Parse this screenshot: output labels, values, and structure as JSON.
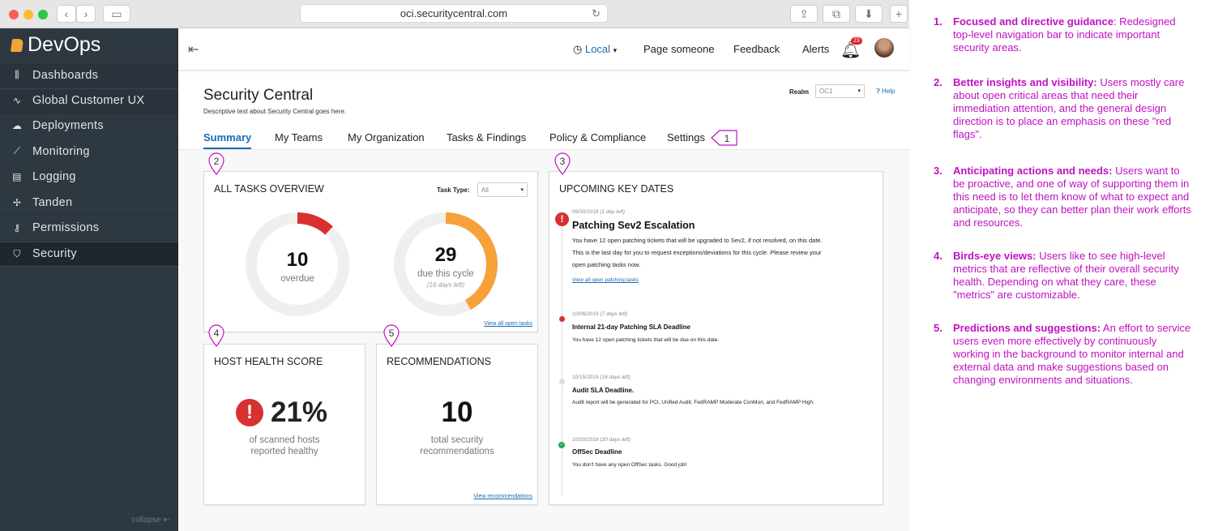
{
  "browser": {
    "url": "oci.securitycentral.com"
  },
  "app": {
    "name": "DevOps",
    "collapse_label": "collapse"
  },
  "sidebar": {
    "items": [
      {
        "label": "Dashboards",
        "icon": "sliders-icon"
      },
      {
        "label": "Global Customer UX",
        "icon": "pulse-icon"
      },
      {
        "label": "Deployments",
        "icon": "cloud-upload-icon"
      },
      {
        "label": "Monitoring",
        "icon": "chart-icon"
      },
      {
        "label": "Logging",
        "icon": "log-icon"
      },
      {
        "label": "Tanden",
        "icon": "tanden-icon"
      },
      {
        "label": "Permissions",
        "icon": "key-icon"
      },
      {
        "label": "Security",
        "icon": "shield-icon"
      }
    ]
  },
  "topbar": {
    "region": "Local",
    "page_someone": "Page someone",
    "feedback": "Feedback",
    "alerts": "Alerts",
    "alert_count": "23"
  },
  "page": {
    "title": "Security Central",
    "description": "Descriptive text about Security Central goes here.",
    "realm_label": "Realm",
    "realm_value": "OC1",
    "help": "Help"
  },
  "tabs": [
    "Summary",
    "My Teams",
    "My Organization",
    "Tasks & Findings",
    "Policy & Compliance",
    "Settings"
  ],
  "tasks": {
    "title": "ALL TASKS OVERVIEW",
    "task_type_label": "Task Type:",
    "task_type_value": "All",
    "overdue_value": "10",
    "overdue_label": "overdue",
    "overdue_fraction": 0.12,
    "due_value": "29",
    "due_label": "due this cycle",
    "due_sub": "(16 days left)",
    "due_fraction": 0.42,
    "view_link": "View all open tasks"
  },
  "host": {
    "title": "HOST HEALTH SCORE",
    "value": "21%",
    "label1": "of scanned hosts",
    "label2": "reported healthy"
  },
  "recs": {
    "title": "RECOMMENDATIONS",
    "value": "10",
    "label1": "total security",
    "label2": "recommendations",
    "link": "View recommendations"
  },
  "dates": {
    "title": "UPCOMING KEY DATES",
    "items": [
      {
        "date": "09/30/2019",
        "rel": "(1 day left)",
        "title": "Patching Sev2 Escalation",
        "desc": [
          "You have 12 open patching tickets that will be upgraded to Sev2, if not resolved, on this date.",
          "This is the last day for you to request exceptions/deviations for this cycle. Please review your",
          "open patching tasks now."
        ],
        "link": "View all open patching tasks",
        "status": "critical"
      },
      {
        "date": "10/06/2019",
        "rel": "(7 days left)",
        "title": "Internal 21-day Patching SLA Deadline",
        "desc": [
          "You have 12 open patching tickets that will be due on this date."
        ],
        "status": "warning"
      },
      {
        "date": "10/15/2019",
        "rel": "(16 days left)",
        "title": "Audit SLA Deadline.",
        "desc": [
          "Audit report will be generated for PCI, Unified Audit, FedRAMP Moderate ConMon, and FedRAMP High."
        ],
        "status": "neutral"
      },
      {
        "date": "10/20/2019",
        "rel": "(20 days left)",
        "title": "OffSec Deadline",
        "desc": [
          "You don't have any open OffSec tasks. Good job!"
        ],
        "status": "ok"
      }
    ]
  },
  "pins": [
    "1",
    "2",
    "3",
    "4",
    "5"
  ],
  "notes": [
    {
      "num": "1.",
      "bold": "Focused and directive guidance",
      "text": ": Redesigned top-level navigation bar to indicate important security areas."
    },
    {
      "num": "2.",
      "bold": "Better insights and visibility:",
      "text": " Users mostly care about open critical areas that need their immediation attention, and the general design direction is to place an emphasis on these \"red flags\"."
    },
    {
      "num": "3.",
      "bold": "Anticipating actions and needs:",
      "text": " Users want to be proactive, and one of way of supporting them in this need is to let them know of what to expect and anticipate, so they can better plan their work efforts and resources."
    },
    {
      "num": "4.",
      "bold": "Birds-eye views:",
      "text": " Users like to see high-level metrics that are reflective of their overall security health. Depending on what they care, these \"metrics\" are customizable."
    },
    {
      "num": "5.",
      "bold": "Predictions and suggestions:",
      "text": " An effort to service users even more effectively by continuously working in the background to monitor internal and external data and make suggestions based on changing environments and situations."
    }
  ],
  "colors": {
    "accent": "#1a6bb0",
    "critical": "#d93030",
    "warning": "#f6a13a",
    "annotation": "#c011c0",
    "sidebar": "#2e3841"
  }
}
